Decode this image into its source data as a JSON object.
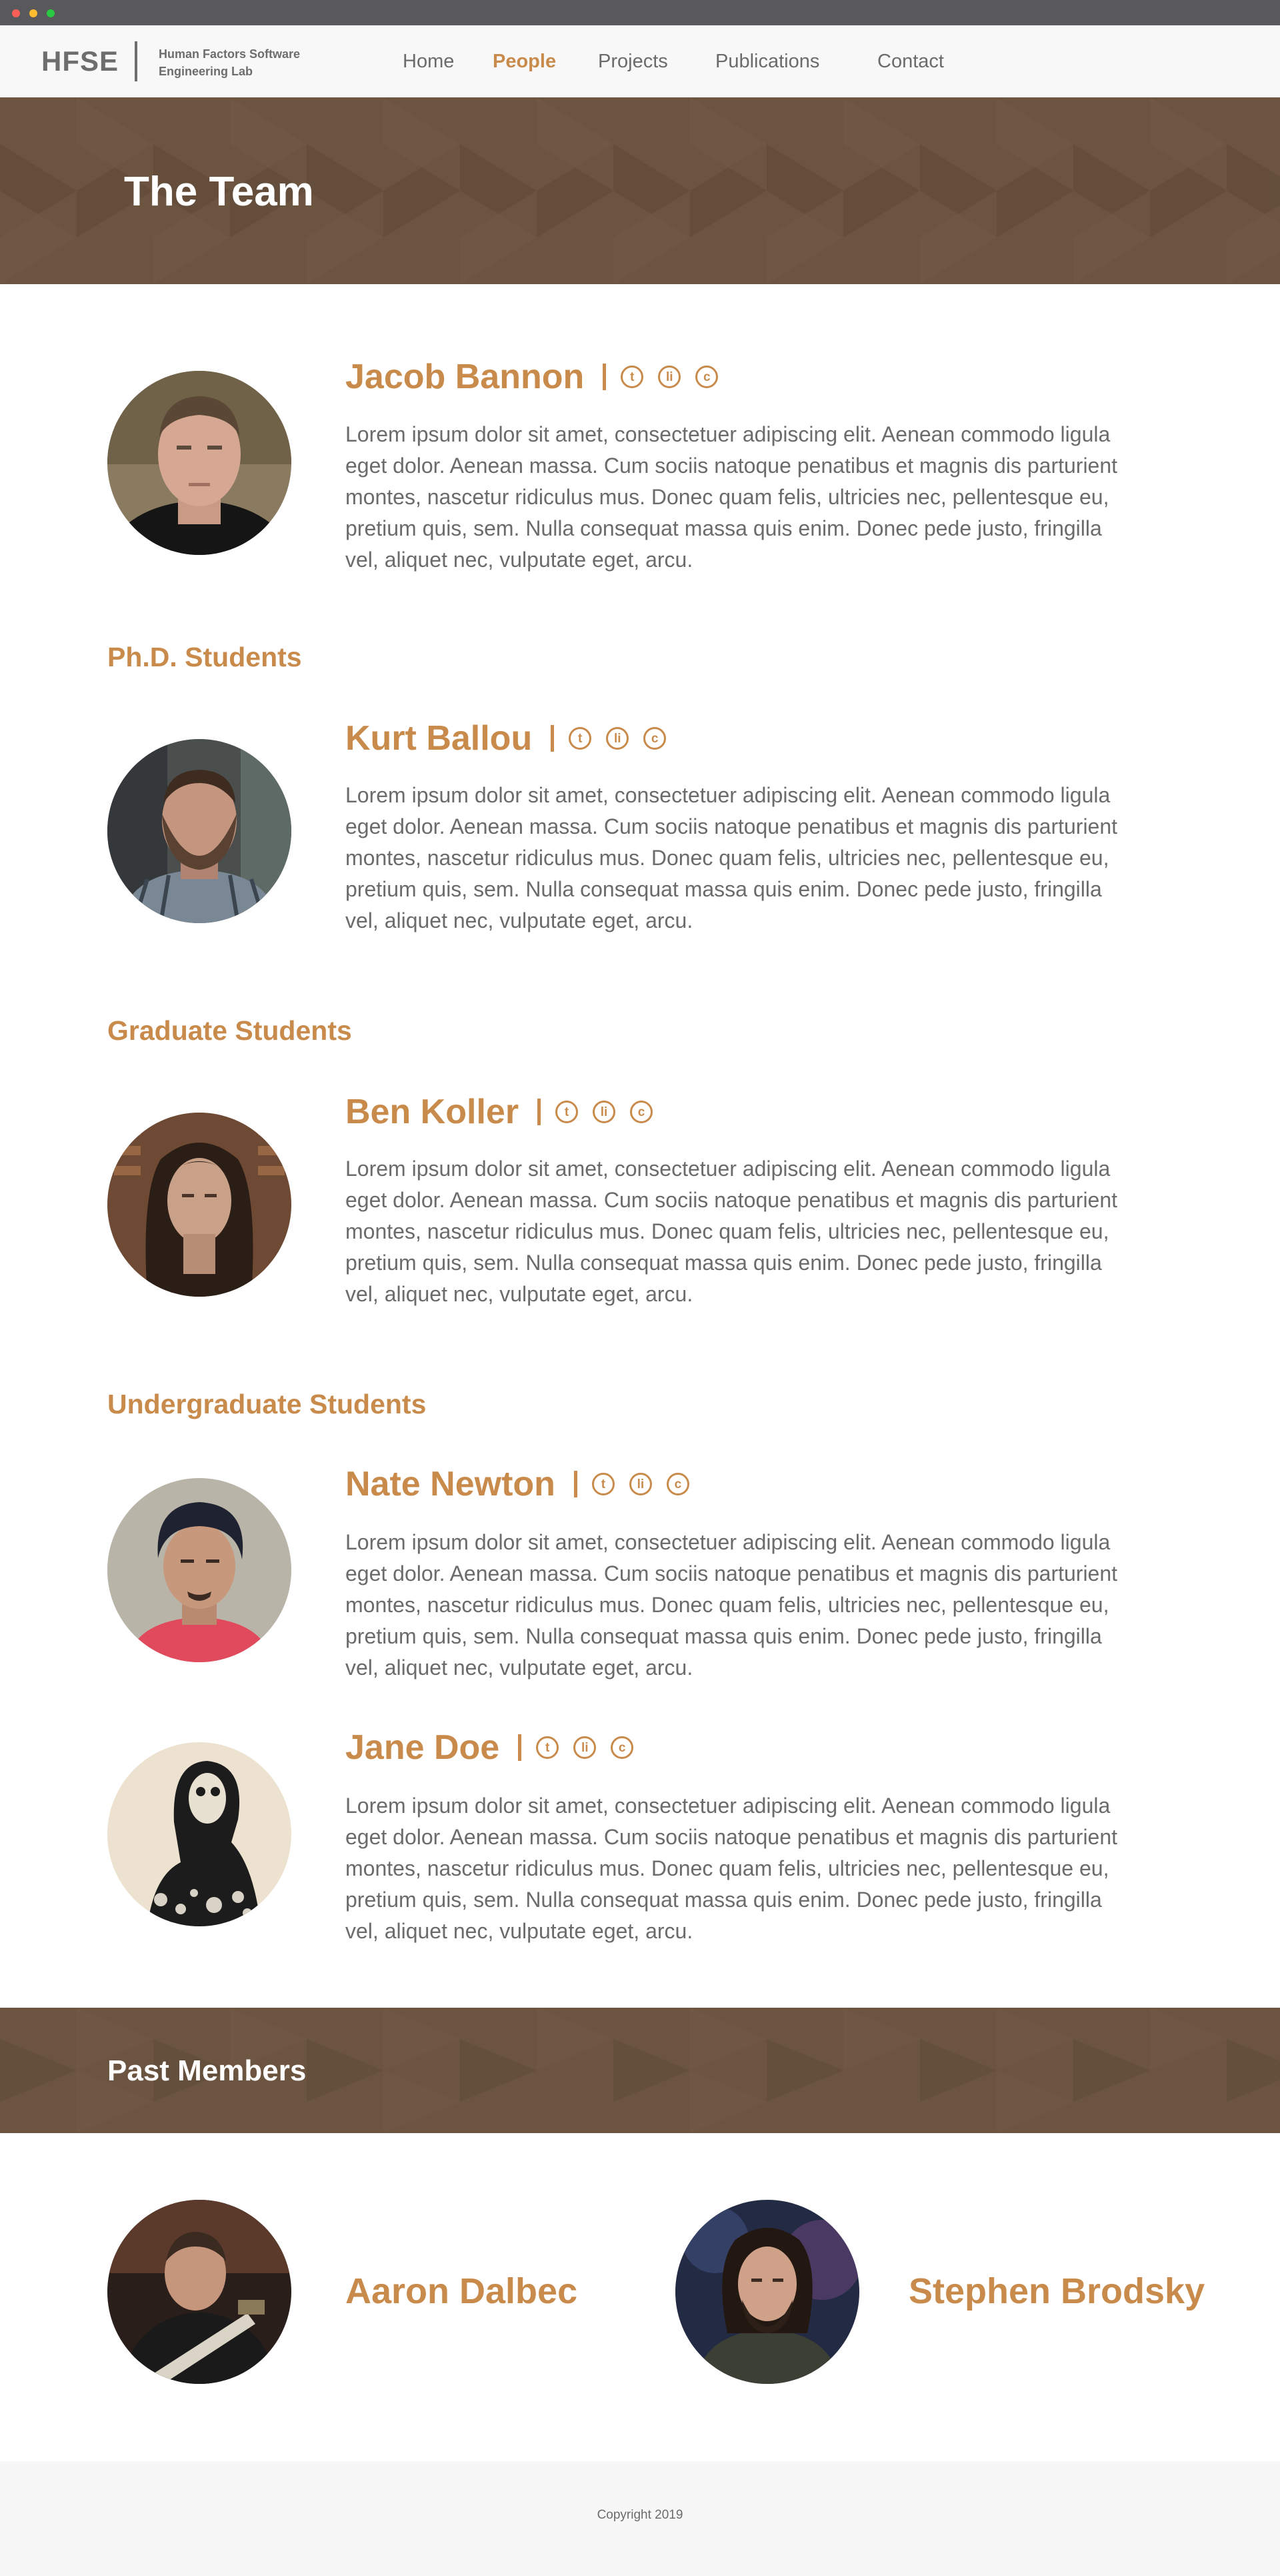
{
  "brand": {
    "abbr": "HFSE",
    "full": "Human Factors Software Engineering Lab"
  },
  "nav": {
    "items": [
      {
        "label": "Home"
      },
      {
        "label": "People",
        "active": true
      },
      {
        "label": "Projects"
      },
      {
        "label": "Publications"
      },
      {
        "label": "Contact"
      }
    ]
  },
  "hero": {
    "title": "The Team"
  },
  "social_icons": [
    "twitter-icon",
    "linkedin-icon",
    "github-icon"
  ],
  "social_glyphs": {
    "twitter": "t",
    "linkedin": "li",
    "github": "c"
  },
  "lead": {
    "name": "Jacob Bannon",
    "bio": "Lorem ipsum dolor sit amet, consectetuer adipiscing elit. Aenean commodo ligula eget dolor. Aenean massa. Cum sociis natoque penatibus et magnis dis parturient montes, nascetur ridiculus mus. Donec quam felis, ultricies nec, pellentesque eu, pretium quis, sem. Nulla consequat massa quis enim. Donec pede justo, fringilla vel, aliquet nec, vulputate eget, arcu."
  },
  "phd": {
    "heading": "Ph.D. Students",
    "members": [
      {
        "name": "Kurt Ballou",
        "bio": "Lorem ipsum dolor sit amet, consectetuer adipiscing elit. Aenean commodo ligula eget dolor. Aenean massa. Cum sociis natoque penatibus et magnis dis parturient montes, nascetur ridiculus mus. Donec quam felis, ultricies nec, pellentesque eu, pretium quis, sem. Nulla consequat massa quis enim. Donec pede justo, fringilla vel, aliquet nec, vulputate eget, arcu."
      }
    ]
  },
  "grad": {
    "heading": "Graduate Students",
    "members": [
      {
        "name": "Ben Koller",
        "bio": "Lorem ipsum dolor sit amet, consectetuer adipiscing elit. Aenean commodo ligula eget dolor. Aenean massa. Cum sociis natoque penatibus et magnis dis parturient montes, nascetur ridiculus mus. Donec quam felis, ultricies nec, pellentesque eu, pretium quis, sem. Nulla consequat massa quis enim. Donec pede justo, fringilla vel, aliquet nec, vulputate eget, arcu."
      }
    ]
  },
  "undergrad": {
    "heading": "Undergraduate Students",
    "members": [
      {
        "name": "Nate Newton",
        "bio": "Lorem ipsum dolor sit amet, consectetuer adipiscing elit. Aenean commodo ligula eget dolor. Aenean massa. Cum sociis natoque penatibus et magnis dis parturient montes, nascetur ridiculus mus. Donec quam felis, ultricies nec, pellentesque eu, pretium quis, sem. Nulla consequat massa quis enim. Donec pede justo, fringilla vel, aliquet nec, vulputate eget, arcu."
      },
      {
        "name": "Jane Doe",
        "bio": "Lorem ipsum dolor sit amet, consectetuer adipiscing elit. Aenean commodo ligula eget dolor. Aenean massa. Cum sociis natoque penatibus et magnis dis parturient montes, nascetur ridiculus mus. Donec quam felis, ultricies nec, pellentesque eu, pretium quis, sem. Nulla consequat massa quis enim. Donec pede justo, fringilla vel, aliquet nec, vulputate eget, arcu."
      }
    ]
  },
  "past": {
    "heading": "Past Members",
    "members": [
      {
        "name": "Aaron Dalbec"
      },
      {
        "name": "Stephen Brodsky"
      }
    ]
  },
  "footer": {
    "copyright": "Copyright 2019"
  },
  "colors": {
    "accent": "#c98b4c",
    "banner": "#6b5440",
    "text": "#6b6b6b",
    "nav_bg": "#f9f8f8",
    "footer_bg": "#f7f7f7"
  }
}
